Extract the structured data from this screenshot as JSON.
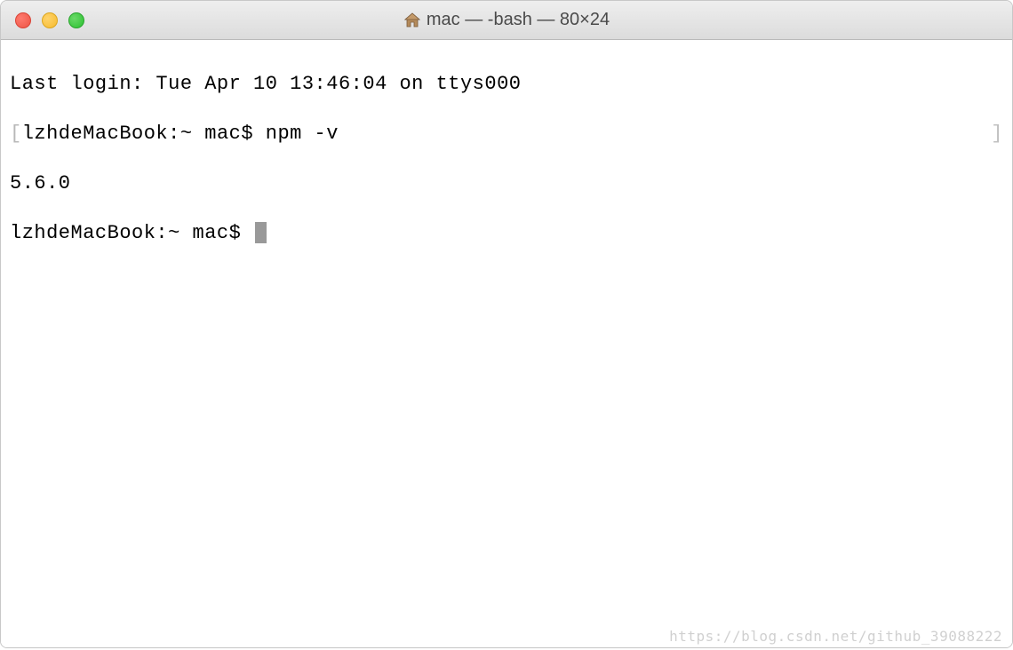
{
  "titlebar": {
    "title": "mac — -bash — 80×24"
  },
  "terminal": {
    "line1": "Last login: Tue Apr 10 13:46:04 on ttys000",
    "line2_bracket_open": "[",
    "line2_prompt": "lzhdeMacBook:~ mac$ ",
    "line2_cmd": "npm -v",
    "line2_bracket_close": "]",
    "line3": "5.6.0",
    "line4_prompt": "lzhdeMacBook:~ mac$ "
  },
  "watermark": "https://blog.csdn.net/github_39088222"
}
